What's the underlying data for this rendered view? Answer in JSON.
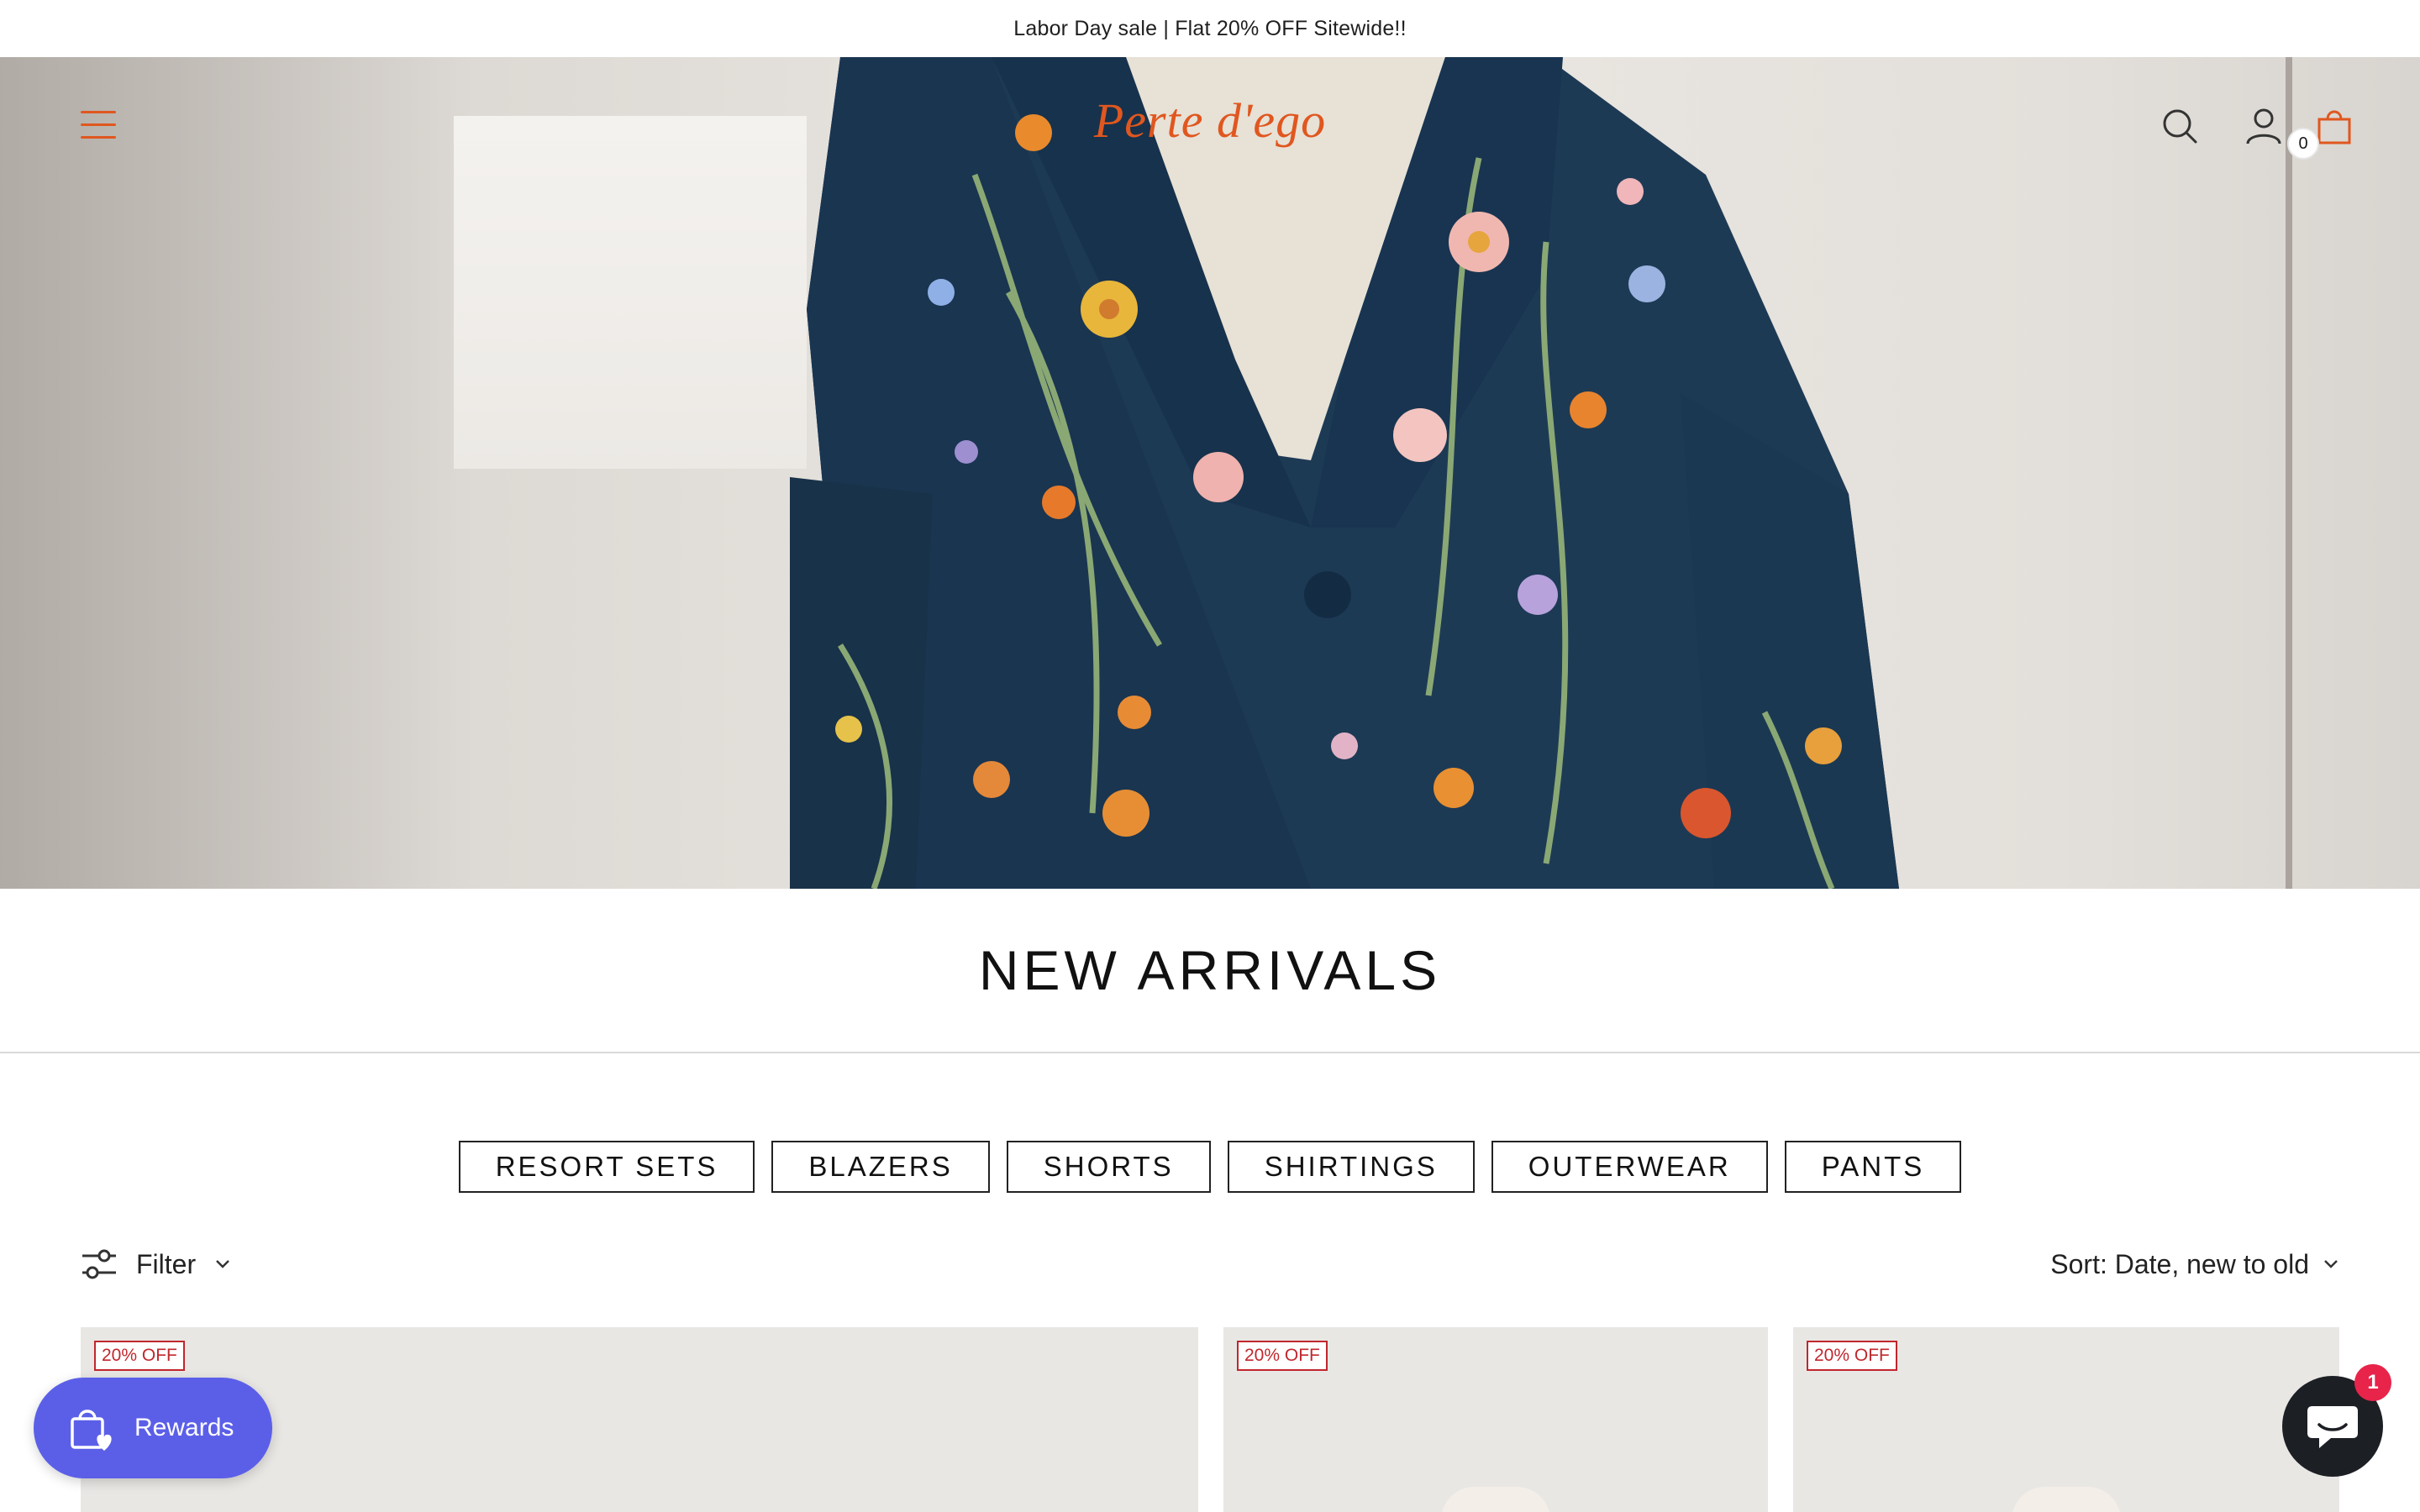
{
  "announcement": {
    "text": "Labor Day sale | Flat 20% OFF Sitewide!!"
  },
  "header": {
    "logo": "Perte d'ego",
    "cart_count": "0",
    "icons": {
      "menu": "hamburger-icon",
      "search": "search-icon",
      "account": "account-icon",
      "cart": "bag-icon"
    },
    "accent_color": "#e0571f"
  },
  "page": {
    "title": "NEW ARRIVALS"
  },
  "categories": [
    {
      "label": "RESORT SETS"
    },
    {
      "label": "BLAZERS"
    },
    {
      "label": "SHORTS"
    },
    {
      "label": "SHIRTINGS"
    },
    {
      "label": "OUTERWEAR"
    },
    {
      "label": "PANTS"
    }
  ],
  "toolbar": {
    "filter_label": "Filter",
    "sort_label": "Sort: Date, new to old"
  },
  "products": [
    {
      "badge": "20% OFF"
    },
    {
      "badge": "20% OFF"
    },
    {
      "badge": "20% OFF"
    }
  ],
  "rewards": {
    "label": "Rewards",
    "color": "#5b5fe8"
  },
  "chat": {
    "unread": "1"
  }
}
